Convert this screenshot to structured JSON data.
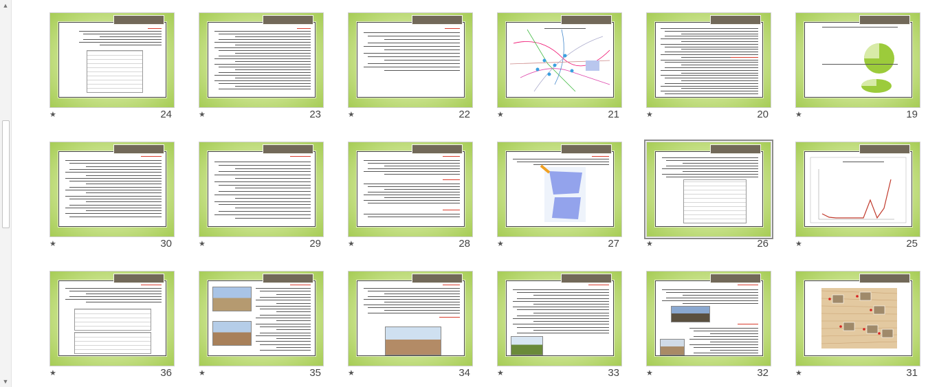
{
  "ui": {
    "star_glyph": "★",
    "scroll_up": "▲",
    "scroll_down": "▼"
  },
  "slides": [
    {
      "number": "24"
    },
    {
      "number": "23"
    },
    {
      "number": "22"
    },
    {
      "number": "21"
    },
    {
      "number": "20"
    },
    {
      "number": "19"
    },
    {
      "number": "30"
    },
    {
      "number": "29"
    },
    {
      "number": "28"
    },
    {
      "number": "27"
    },
    {
      "number": "26"
    },
    {
      "number": "25"
    },
    {
      "number": "36"
    },
    {
      "number": "35"
    },
    {
      "number": "34"
    },
    {
      "number": "33"
    },
    {
      "number": "32"
    },
    {
      "number": "31"
    }
  ],
  "colors": {
    "slide_green": "#a6cc55",
    "title_tab": "#726959",
    "heading_red": "#d83a2a"
  }
}
